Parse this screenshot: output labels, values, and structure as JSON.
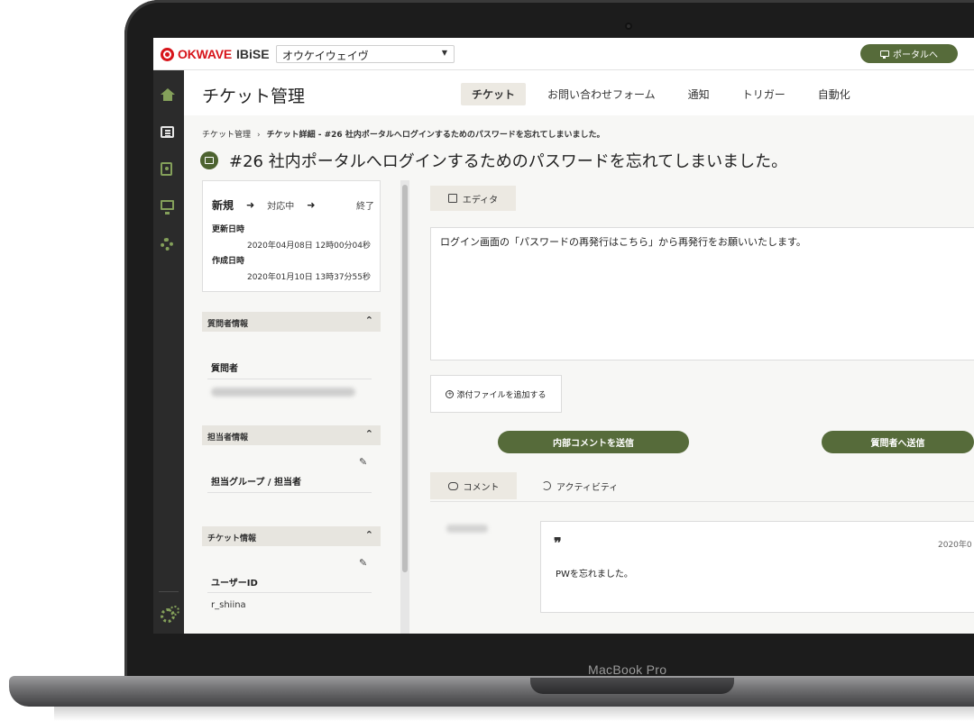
{
  "device": {
    "brand": "MacBook Pro"
  },
  "topbar": {
    "logo_primary": "OKWAVE",
    "logo_secondary": "IBiSE",
    "org_select": "オウケイウェイヴ",
    "portal_button": "ポータルへ"
  },
  "sidenav": {
    "icons": [
      "home-icon",
      "list-icon",
      "book-icon",
      "monitor-icon",
      "gear-icon",
      "gears-icon"
    ]
  },
  "header": {
    "title": "チケット管理",
    "tabs": [
      {
        "label": "チケット",
        "active": true
      },
      {
        "label": "お問い合わせフォーム"
      },
      {
        "label": "通知"
      },
      {
        "label": "トリガー"
      },
      {
        "label": "自動化"
      }
    ]
  },
  "breadcrumb": {
    "root": "チケット管理",
    "separator": "›",
    "current": "チケット詳細 - #26 社内ポータルへログインするためのパスワードを忘れてしまいました。"
  },
  "ticket": {
    "title": "#26 社内ポータルへログインするためのパスワードを忘れてしまいました。",
    "status": {
      "current": "新規",
      "next": "対応中",
      "last": "終了"
    },
    "updated_label": "更新日時",
    "updated_value": "2020年04月08日 12時00分04秒",
    "created_label": "作成日時",
    "created_value": "2020年01月10日 13時37分55秒"
  },
  "sections": {
    "requester": {
      "title": "質問者情報",
      "field_label": "質問者"
    },
    "assignee": {
      "title": "担当者情報",
      "field_label": "担当グループ / 担当者"
    },
    "ticket_info": {
      "title": "チケット情報",
      "field_label": "ユーザーID",
      "field_value": "r_shiina"
    }
  },
  "editor": {
    "tab_label": "エディタ",
    "content": "ログイン画面の「パスワードの再発行はこちら」から再発行をお願いいたします。",
    "attach_label": "添付ファイルを追加する",
    "internal_comment_button": "内部コメントを送信",
    "send_to_requester_button": "質問者へ送信"
  },
  "comments": {
    "tabs": [
      {
        "label": "コメント",
        "active": true
      },
      {
        "label": "アクティビティ"
      }
    ],
    "items": [
      {
        "quote": "❞",
        "date": "2020年0",
        "text": "PWを忘れました。"
      }
    ]
  },
  "colors": {
    "accent": "#566b3a",
    "logo_red": "#d7141a",
    "nav_icon": "#84a05a",
    "sidebar_bg": "#2b2b2b"
  }
}
